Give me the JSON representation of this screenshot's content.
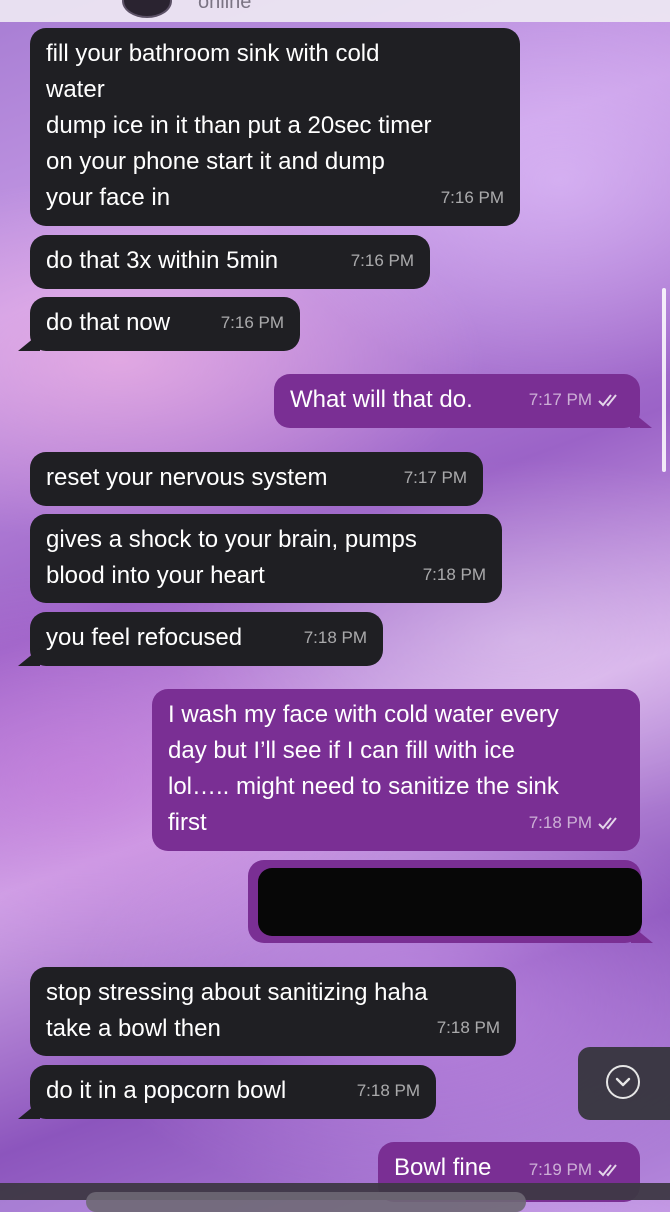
{
  "header": {
    "contact_status": "online"
  },
  "messages": [
    {
      "text": "fill your bathroom sink with cold\nwater\ndump ice in it than put a 20sec timer\non your phone start it and dump\nyour face in",
      "time": "7:16 PM"
    },
    {
      "text": "do that 3x within 5min",
      "time": "7:16 PM"
    },
    {
      "text": "do that now",
      "time": "7:16 PM"
    },
    {
      "text": "What will that do.",
      "time": "7:17 PM"
    },
    {
      "text": "reset your nervous system",
      "time": "7:17 PM"
    },
    {
      "text": "gives a shock to your brain, pumps\nblood into your heart",
      "time": "7:18 PM"
    },
    {
      "text": "you feel refocused",
      "time": "7:18 PM"
    },
    {
      "text": "I wash my face with cold water every\nday but I’ll see if I can fill with ice\nlol….. might need to sanitize the sink\nfirst",
      "time": "7:18 PM"
    },
    {
      "text": "stop stressing about sanitizing haha\ntake a bowl then",
      "time": "7:18 PM"
    },
    {
      "text": "do it in a popcorn bowl",
      "time": "7:18 PM"
    },
    {
      "text": "Bowl fine",
      "time": "7:19 PM"
    }
  ],
  "colors": {
    "incoming": "#1f1f23",
    "outgoing": "#7a2f94",
    "redaction": "#070707"
  },
  "icons": {
    "read_receipt": "double-check-icon",
    "scroll_down": "chevron-down-icon"
  }
}
